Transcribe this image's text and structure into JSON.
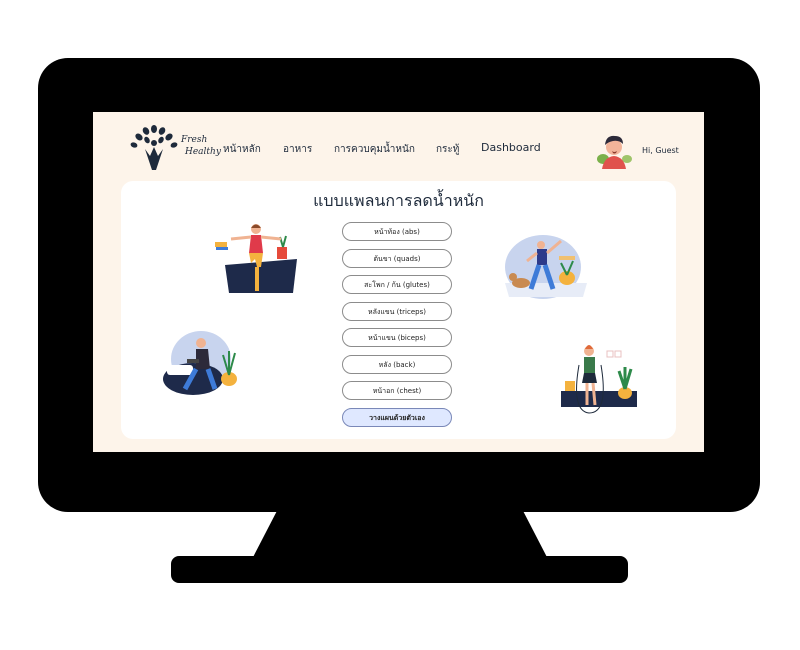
{
  "header": {
    "brand_line1": "Fresh",
    "brand_line2": "Healthy",
    "nav": [
      "หน้าหลัก",
      "อาหาร",
      "การควบคุมน้ำหนัก",
      "กระทู้",
      "Dashboard"
    ],
    "greeting": "Hi, Guest"
  },
  "main": {
    "title": "แบบแพลนการลดน้ำหนัก",
    "plan_buttons": [
      "หน้าท้อง (abs)",
      "ต้นขา (quads)",
      "สะโพก / ก้น (glutes)",
      "หลังแขน (triceps)",
      "หน้าแขน (biceps)",
      "หลัง (back)",
      "หน้าอก (chest)"
    ],
    "custom_plan_button": "วางแผนด้วยตัวเอง"
  },
  "colors": {
    "screen_bg": "#fdf4ea",
    "card_bg": "#ffffff",
    "text_dark": "#1e2a3b",
    "custom_button_bg": "#dfe8ff"
  },
  "icons": {
    "logo": "tree-person-icon",
    "avatar": "user-avatar-icon"
  }
}
